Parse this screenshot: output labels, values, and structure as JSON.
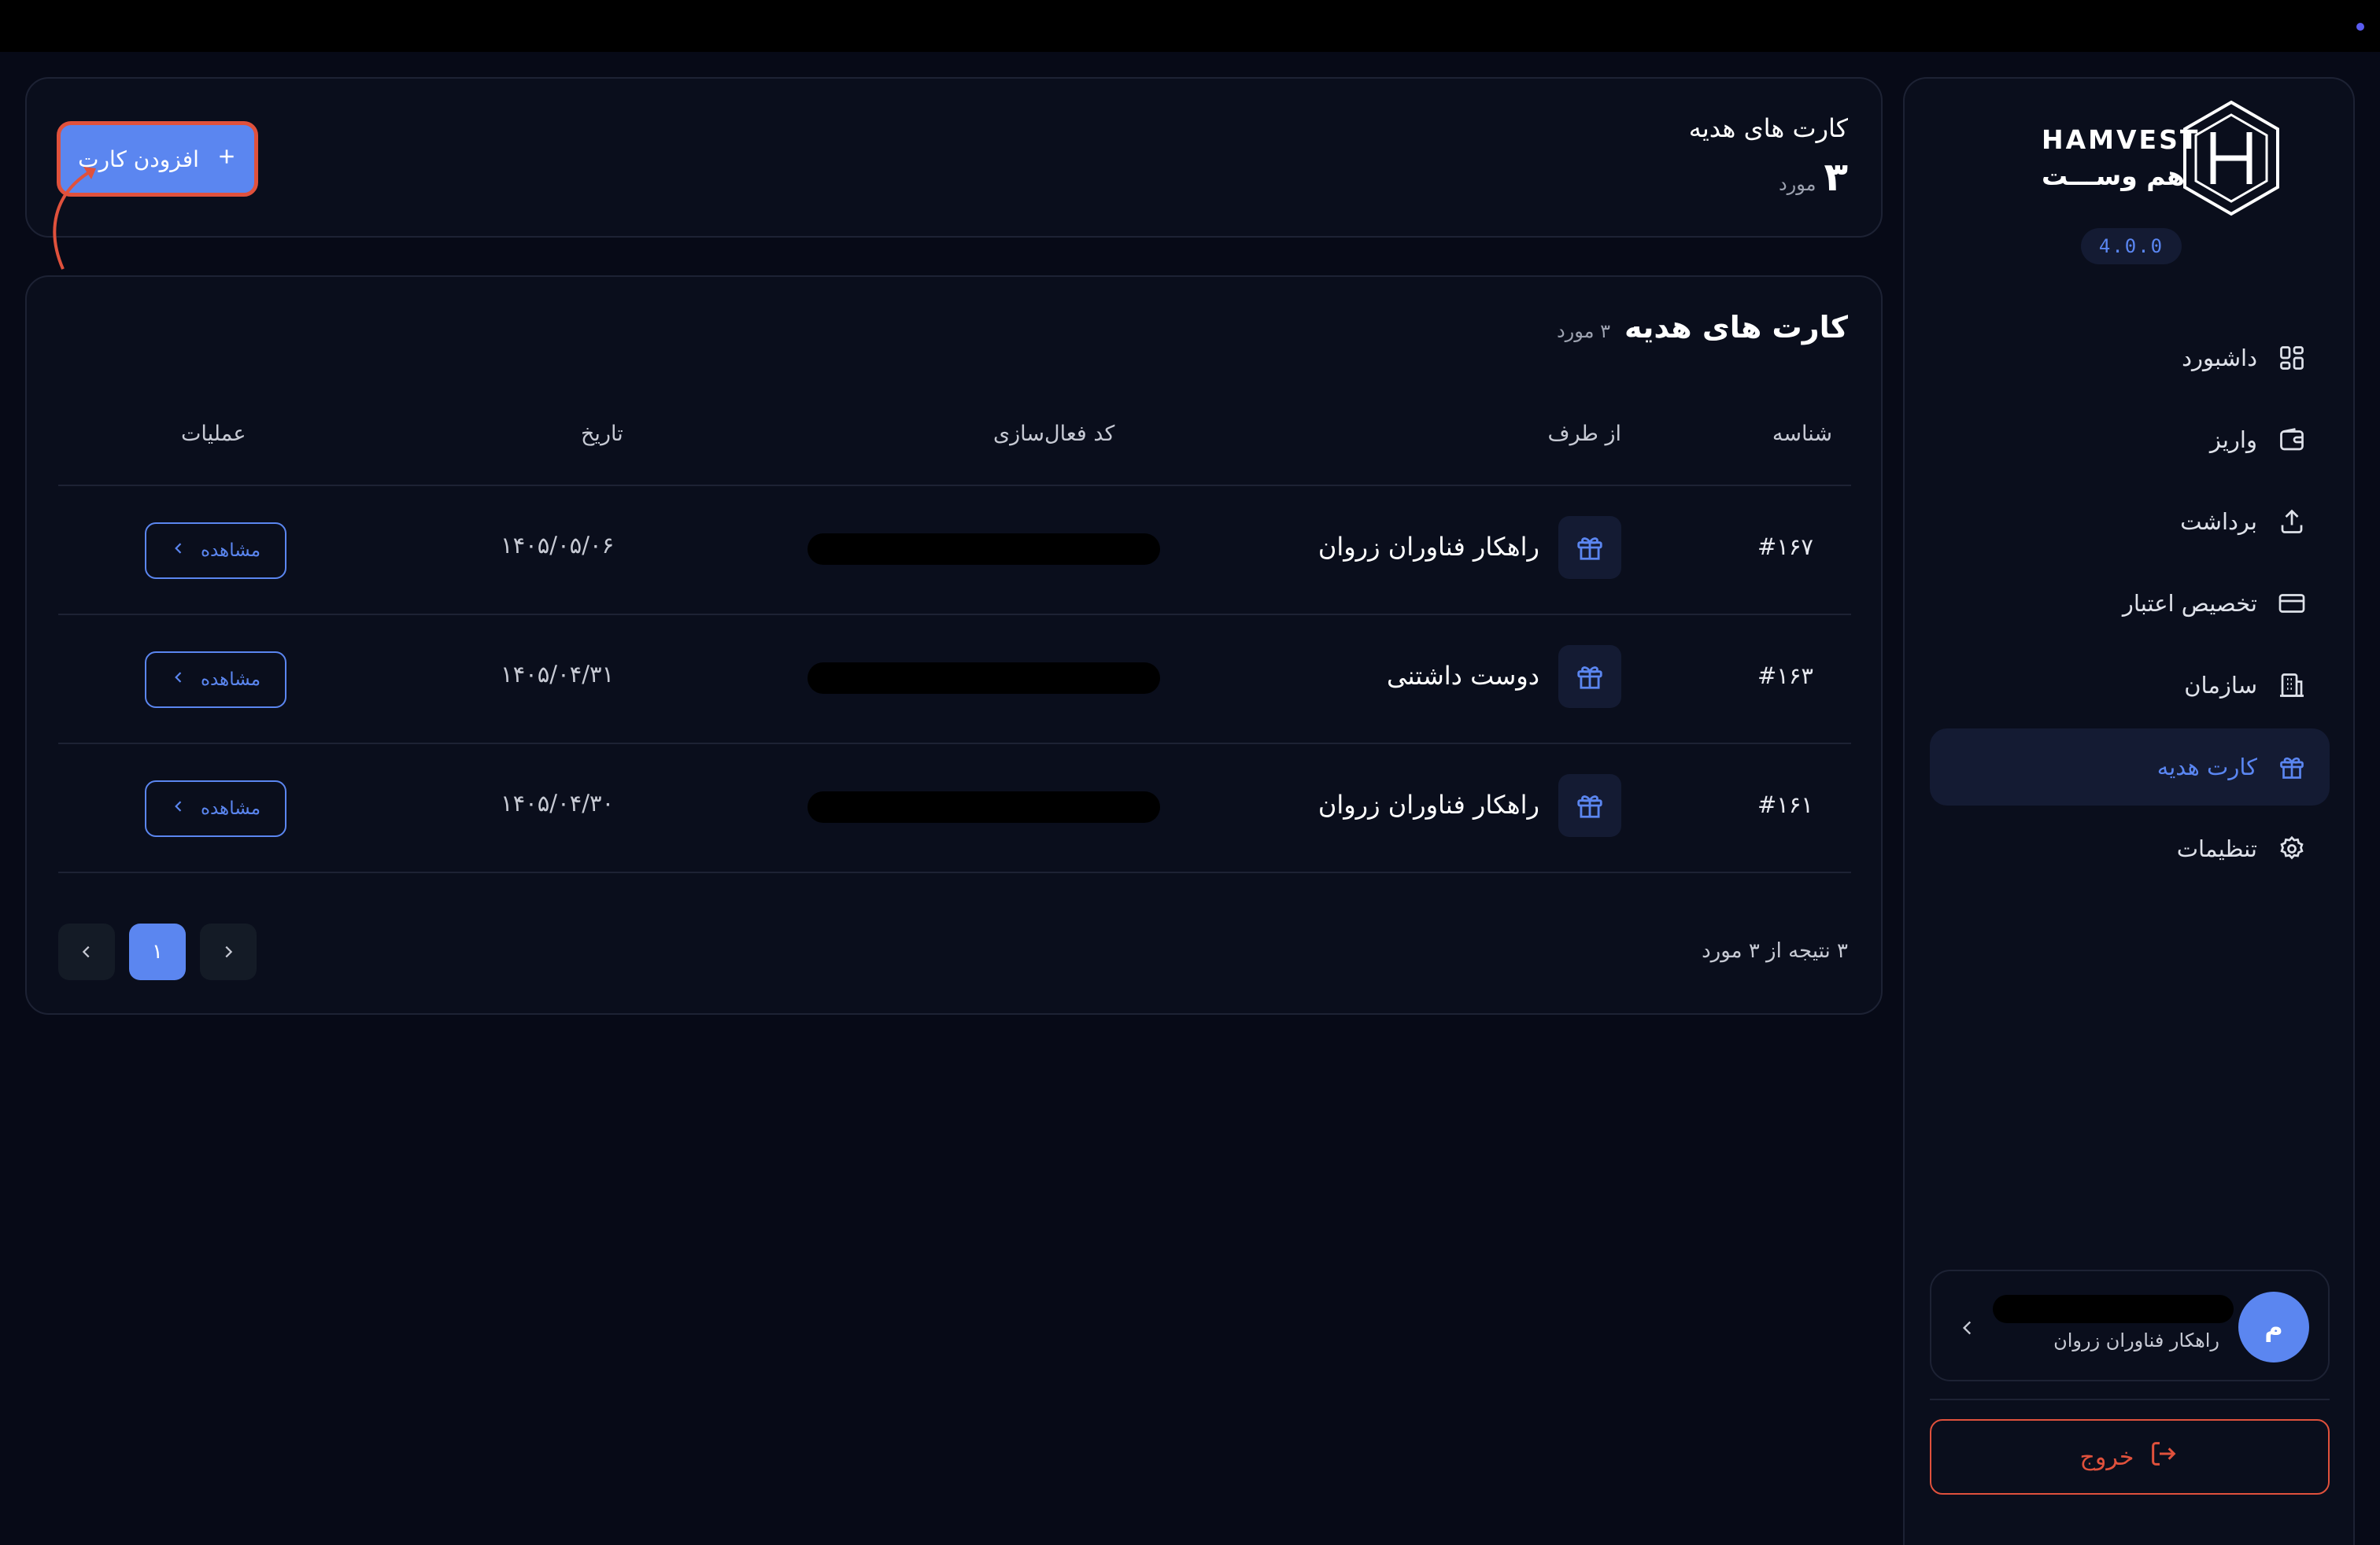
{
  "colors": {
    "background": "#070a17",
    "panel": "#0a0e1c",
    "accent": "#5b86f0",
    "danger": "#e0513c",
    "border": "#1d2234"
  },
  "brand": {
    "name_en": "HAMVEST",
    "name_fa": "هم وســـت",
    "version": "4.0.0"
  },
  "sidebar": {
    "items": [
      {
        "label": "داشبورد",
        "icon": "dashboard-grid-icon",
        "active": false
      },
      {
        "label": "واریز",
        "icon": "wallet-icon",
        "active": false
      },
      {
        "label": "برداشت",
        "icon": "upload-icon",
        "active": false
      },
      {
        "label": "تخصیص اعتبار",
        "icon": "credit-card-icon",
        "active": false
      },
      {
        "label": "سازمان",
        "icon": "building-icon",
        "active": false
      },
      {
        "label": "کارت هدیه",
        "icon": "gift-icon",
        "active": true
      },
      {
        "label": "تنظیمات",
        "icon": "gear-icon",
        "active": false
      }
    ],
    "user": {
      "avatar_initial": "م",
      "organization": "راهکار فناوران زروان"
    },
    "logout_label": "خروج"
  },
  "header": {
    "title": "کارت های هدیه",
    "count": "۳",
    "count_unit": "مورد",
    "add_button_label": "افزودن کارت",
    "add_button_icon": "plus-icon"
  },
  "table": {
    "title": "کارت های هدیه",
    "count_label": "۳ مورد",
    "columns": {
      "id": "شناسه",
      "from": "از طرف",
      "code": "کد فعال‌سازی",
      "date": "تاریخ",
      "actions": "عملیات"
    },
    "rows": [
      {
        "id": "#۱۶۷",
        "from": "راهکار فناوران زروان",
        "date": "۱۴۰۵/۰۵/۰۶",
        "action": "مشاهده"
      },
      {
        "id": "#۱۶۳",
        "from": "دوست داشتنی",
        "date": "۱۴۰۵/۰۴/۳۱",
        "action": "مشاهده"
      },
      {
        "id": "#۱۶۱",
        "from": "راهکار فناوران زروان",
        "date": "۱۴۰۵/۰۴/۳۰",
        "action": "مشاهده"
      }
    ],
    "results_label": "۳ نتیجه از ۳ مورد",
    "pagination": {
      "current_page": "۱"
    }
  }
}
